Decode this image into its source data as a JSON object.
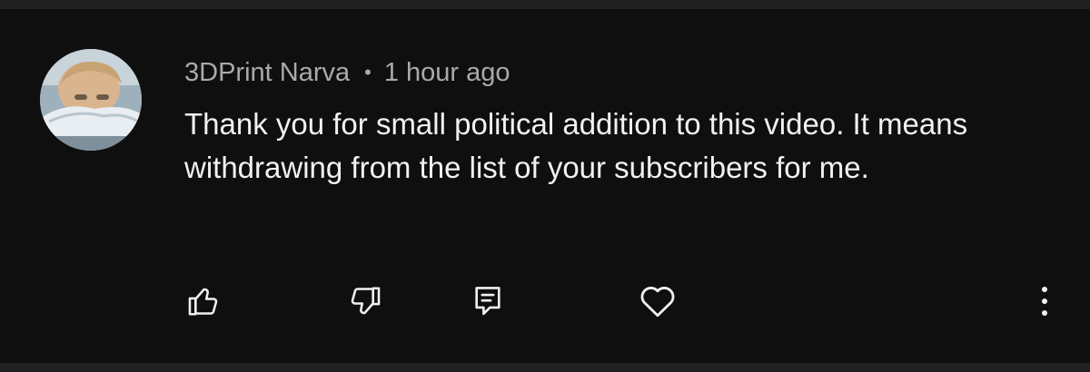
{
  "comment": {
    "author": "3DPrint Narva",
    "separator": "•",
    "timestamp": "1 hour ago",
    "text": "Thank you for small political addition to this video. It means withdrawing from the list of your subscribers for me."
  },
  "actions": {
    "like_icon": "thumbs-up-icon",
    "dislike_icon": "thumbs-down-icon",
    "reply_icon": "reply-comment-icon",
    "heart_icon": "heart-icon",
    "more_icon": "more-vertical-icon"
  },
  "colors": {
    "background": "#0f0f0f",
    "text_primary": "#f1f1f1",
    "text_secondary": "#aaaaaa"
  }
}
